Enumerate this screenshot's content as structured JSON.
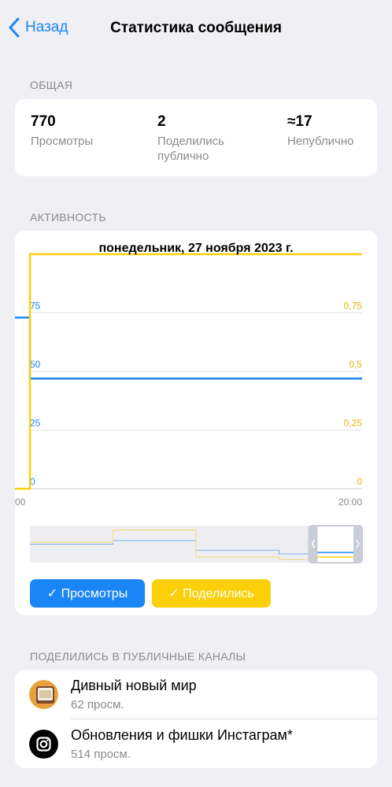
{
  "nav": {
    "back_label": "Назад",
    "title": "Статистика сообщения"
  },
  "overview": {
    "section_label": "ОБЩАЯ",
    "stats": [
      {
        "value": "770",
        "label": "Просмотры"
      },
      {
        "value": "2",
        "label": "Поделились публично"
      },
      {
        "value": "≈17",
        "label": "Непублично"
      }
    ]
  },
  "activity": {
    "section_label": "АКТИВНОСТЬ",
    "toggles": {
      "views_label": "✓ Просмотры",
      "shares_label": "✓ Поделились"
    }
  },
  "chart_data": {
    "type": "line",
    "title": "понедельник, 27 ноября 2023 г.",
    "x_ticks": [
      "00",
      "20:00"
    ],
    "left_axis": {
      "ticks": [
        "0",
        "25",
        "50",
        "75"
      ],
      "range": [
        0,
        100
      ]
    },
    "right_axis": {
      "ticks": [
        "0",
        "0,25",
        "0,5",
        "0,75"
      ],
      "range": [
        0,
        1
      ]
    },
    "series": [
      {
        "name": "Просмотры",
        "color": "#1a86f5",
        "axis": "left",
        "x": [
          0,
          23
        ],
        "values": [
          73,
          47
        ]
      },
      {
        "name": "Поделились",
        "color": "#fbd008",
        "axis": "right",
        "x": [
          0,
          23
        ],
        "values": [
          0,
          1
        ]
      }
    ],
    "grid": true,
    "navigator": {
      "views": [
        25,
        31,
        15,
        9
      ],
      "shares": [
        28,
        48,
        4,
        0
      ],
      "selected_range": [
        0.84,
        1.0
      ]
    }
  },
  "channels": {
    "section_label": "ПОДЕЛИЛИСЬ В ПУБЛИЧНЫЕ КАНАЛЫ",
    "items": [
      {
        "name": "Дивный новый мир",
        "views": "62 просм.",
        "icon": "avatar-image"
      },
      {
        "name": "Обновления и фишки Инстаграм*",
        "views": "514 просм.",
        "icon": "instagram-icon"
      }
    ]
  },
  "colors": {
    "accent": "#1a86f5",
    "shares": "#fbd008",
    "background": "#efeff4",
    "secondary_text": "#8a8a8e"
  }
}
